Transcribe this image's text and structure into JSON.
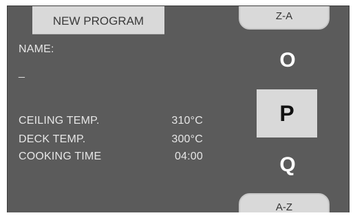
{
  "header": {
    "new_program_label": "NEW PROGRAM"
  },
  "program": {
    "name_label": "NAME:",
    "name_value": "_",
    "settings": [
      {
        "label": "CEILING TEMP.",
        "value": "310°C"
      },
      {
        "label": "DECK TEMP.",
        "value": "300°C"
      },
      {
        "label": "COOKING TIME",
        "value": "04:00"
      }
    ]
  },
  "letter_selector": {
    "sort_desc_label": "Z-A",
    "sort_asc_label": "A-Z",
    "prev_letter": "O",
    "selected_letter": "P",
    "next_letter": "Q"
  },
  "colors": {
    "screen_background": "#5b5b5b",
    "button_background": "#d9d9d9"
  }
}
